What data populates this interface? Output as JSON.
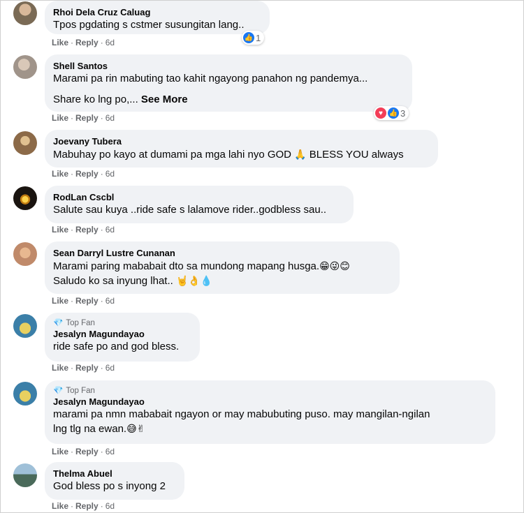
{
  "comments": [
    {
      "author": "Rhoi Dela Cruz Caluag",
      "lines": [
        "Tpos pgdating s cstmer susungitan lang.."
      ],
      "like": "Like",
      "reply": "Reply",
      "time": "6d",
      "reaction_count": "1",
      "avatar_color": "#7a6a55"
    },
    {
      "author": "Shell Santos",
      "lines": [
        "Marami pa rin mabuting tao kahit ngayong panahon ng pandemya...",
        "Share ko lng po,..."
      ],
      "see_more": "See More",
      "like": "Like",
      "reply": "Reply",
      "time": "6d",
      "reaction_count": "3",
      "avatar_color": "#a0948a"
    },
    {
      "author": "Joevany Tubera",
      "lines": [
        "Mabuhay po kayo at dumami pa mga lahi nyo GOD",
        "BLESS YOU always"
      ],
      "emoji": "🙏",
      "like": "Like",
      "reply": "Reply",
      "time": "6d",
      "avatar_color": "#8c6a48"
    },
    {
      "author": "RodLan Cscbl",
      "lines": [
        "Salute sau kuya ..ride safe s lalamove rider..godbless sau.."
      ],
      "like": "Like",
      "reply": "Reply",
      "time": "6d",
      "avatar_color": "#1a1410"
    },
    {
      "author": "Sean Darryl Lustre Cunanan",
      "lines": [
        "Marami paring mababait dto sa mundong mapang husga.",
        "Saludo ko sa inyung lhat.."
      ],
      "emoji_1": "😁😜😊",
      "emoji_2": "🤘👌💧",
      "like": "Like",
      "reply": "Reply",
      "time": "6d",
      "avatar_color": "#c08a6a"
    },
    {
      "badge": "Top Fan",
      "author": "Jesalyn Magundayao",
      "lines": [
        "ride safe po and god bless."
      ],
      "like": "Like",
      "reply": "Reply",
      "time": "6d",
      "avatar_color": "#3b7fa8"
    },
    {
      "badge": "Top Fan",
      "author": "Jesalyn Magundayao",
      "lines": [
        "marami pa nmn mababait ngayon or may mabubuting puso. may mangilan-ngilan",
        "lng tlg na ewan."
      ],
      "emoji": "😅✌",
      "like": "Like",
      "reply": "Reply",
      "time": "6d",
      "avatar_color": "#3b7fa8"
    },
    {
      "author": "Thelma Abuel",
      "lines": [
        "God bless po s inyong 2"
      ],
      "like": "Like",
      "reply": "Reply",
      "time": "6d",
      "avatar_color": "#6a8aa0"
    }
  ],
  "separator": "·"
}
